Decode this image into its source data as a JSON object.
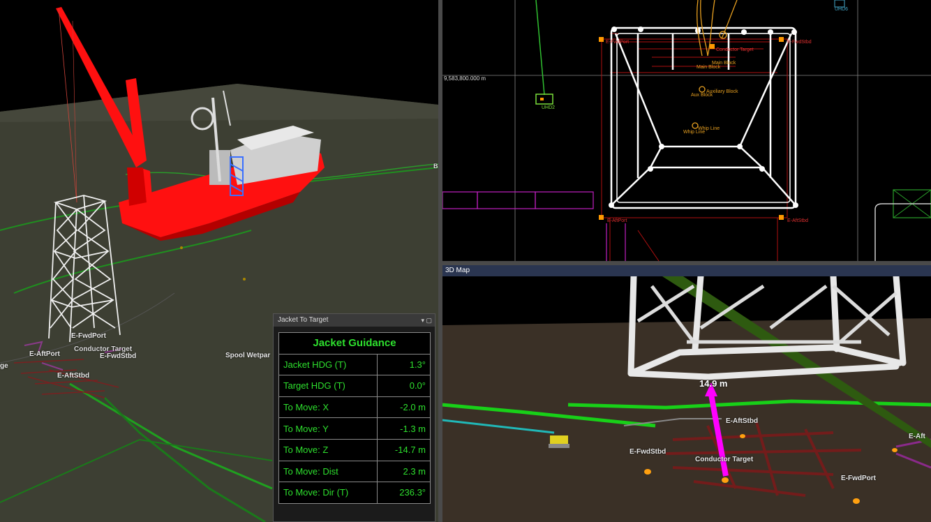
{
  "left_view": {
    "labels": {
      "fwd_port": "E-FwdPort",
      "conductor_target": "Conductor Target",
      "aft_port": "E-AftPort",
      "fwd_stbd": "E-FwdStbd",
      "aft_stbd": "E-AftStbd",
      "spool": "Spool Wetpar",
      "edge_left": "ge",
      "edge_right": "B"
    }
  },
  "guidance_panel": {
    "title": "Jacket To Target",
    "buttons": "▾  ▢",
    "heading": "Jacket Guidance",
    "rows": [
      {
        "label": "Jacket HDG (T)",
        "value": "1.3°"
      },
      {
        "label": "Target HDG (T)",
        "value": "0.0°"
      },
      {
        "label": "To Move: X",
        "value": "-2.0 m"
      },
      {
        "label": "To Move: Y",
        "value": "-1.3 m"
      },
      {
        "label": "To Move: Z",
        "value": "-14.7 m"
      },
      {
        "label": "To Move: Dist",
        "value": "2.3 m"
      },
      {
        "label": "To Move: Dir (T)",
        "value": "236.3°"
      }
    ]
  },
  "plan_view": {
    "northing": "9,583,800.000 m",
    "labels": {
      "uhd6": "UHD6",
      "uhd2": "UHD2",
      "fwd_port": "E-FwdPort",
      "fwd_stbd": "E-FwdStbd",
      "aft_port": "E-AftPort",
      "aft_stbd": "E-AftStbd",
      "conductor_target": "Conductor Target",
      "main_block": "Main Block",
      "main_block2": "Main Block",
      "aux_block": "Auxiliary Block",
      "aux_block2": "Aux Block",
      "whip_line": "Whip Line",
      "whip_line2": "Whip Line"
    }
  },
  "map3d": {
    "title": "3D Map",
    "distance": "14.9 m",
    "labels": {
      "aft_stbd": "E-AftStbd",
      "fwd_stbd": "E-FwdStbd",
      "conductor_target": "Conductor Target",
      "fwd_port": "E-FwdPort",
      "aft_port": "E-Aft"
    }
  },
  "colors": {
    "vessel": "#ff1010",
    "guidance_text": "#2ee02e",
    "seabed": "#3d3f33",
    "pipeline": "#1fa01f",
    "distance_line": "#ff00ff"
  }
}
